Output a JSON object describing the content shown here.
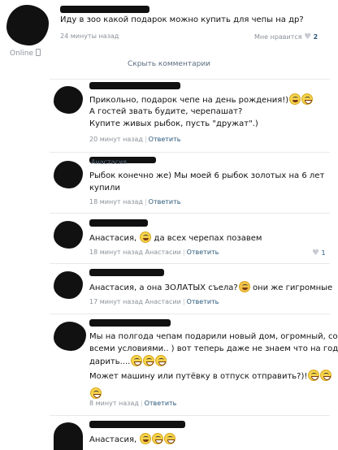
{
  "post": {
    "text": "Иду в зоо какой подарок можно купить для чепы на др?",
    "time": "24 минуты назад",
    "status": "Online",
    "like_label": "Мне нравится",
    "like_count": "2"
  },
  "hide_comments": "Скрыть комментарии",
  "comments": [
    {
      "lines": [
        "Прикольно, подарок чепе на день рождения!)",
        "А гостей звать будите, черепашат?",
        "Купите живых рыбок, пусть \"дружат\".)"
      ],
      "time": "20 минут назад",
      "reply": "Ответить"
    },
    {
      "tag": "Анастасия",
      "lines": [
        "Рыбок конечно же) Мы моей 6 рыбок золотых на 6 лет",
        "купили"
      ],
      "time": "18 минут назад",
      "reply": "Ответить"
    },
    {
      "lines": [
        "Анастасия,",
        "да всех черепах позавем"
      ],
      "time": "18 минут назад Анастасии",
      "reply": "Ответить",
      "likes": "1"
    },
    {
      "lines": [
        "Анастасия, а она ЗОЛАТЫХ съела?",
        "они же гигромные"
      ],
      "time": "17 минут назад Анастасии",
      "reply": "Ответить"
    },
    {
      "lines": [
        "Мы на полгода чепам подарили новый дом, огромный, со",
        "всеми условиями.. ) вот теперь даже не знаем что на год",
        "дарить....",
        "Может машину или путёвку в отпуск отправить?)!"
      ],
      "time": "8 минут назад",
      "reply": "Ответить"
    },
    {
      "lines": [
        "Анастасия,"
      ]
    }
  ],
  "colors": {
    "link": "#2b587a",
    "meta": "#8a9099",
    "divider": "#e7e9ec"
  },
  "icons": [
    "phone-icon",
    "heart-icon",
    "laughing-emoji-icon",
    "smile-emoji-icon",
    "surprised-emoji-icon"
  ]
}
